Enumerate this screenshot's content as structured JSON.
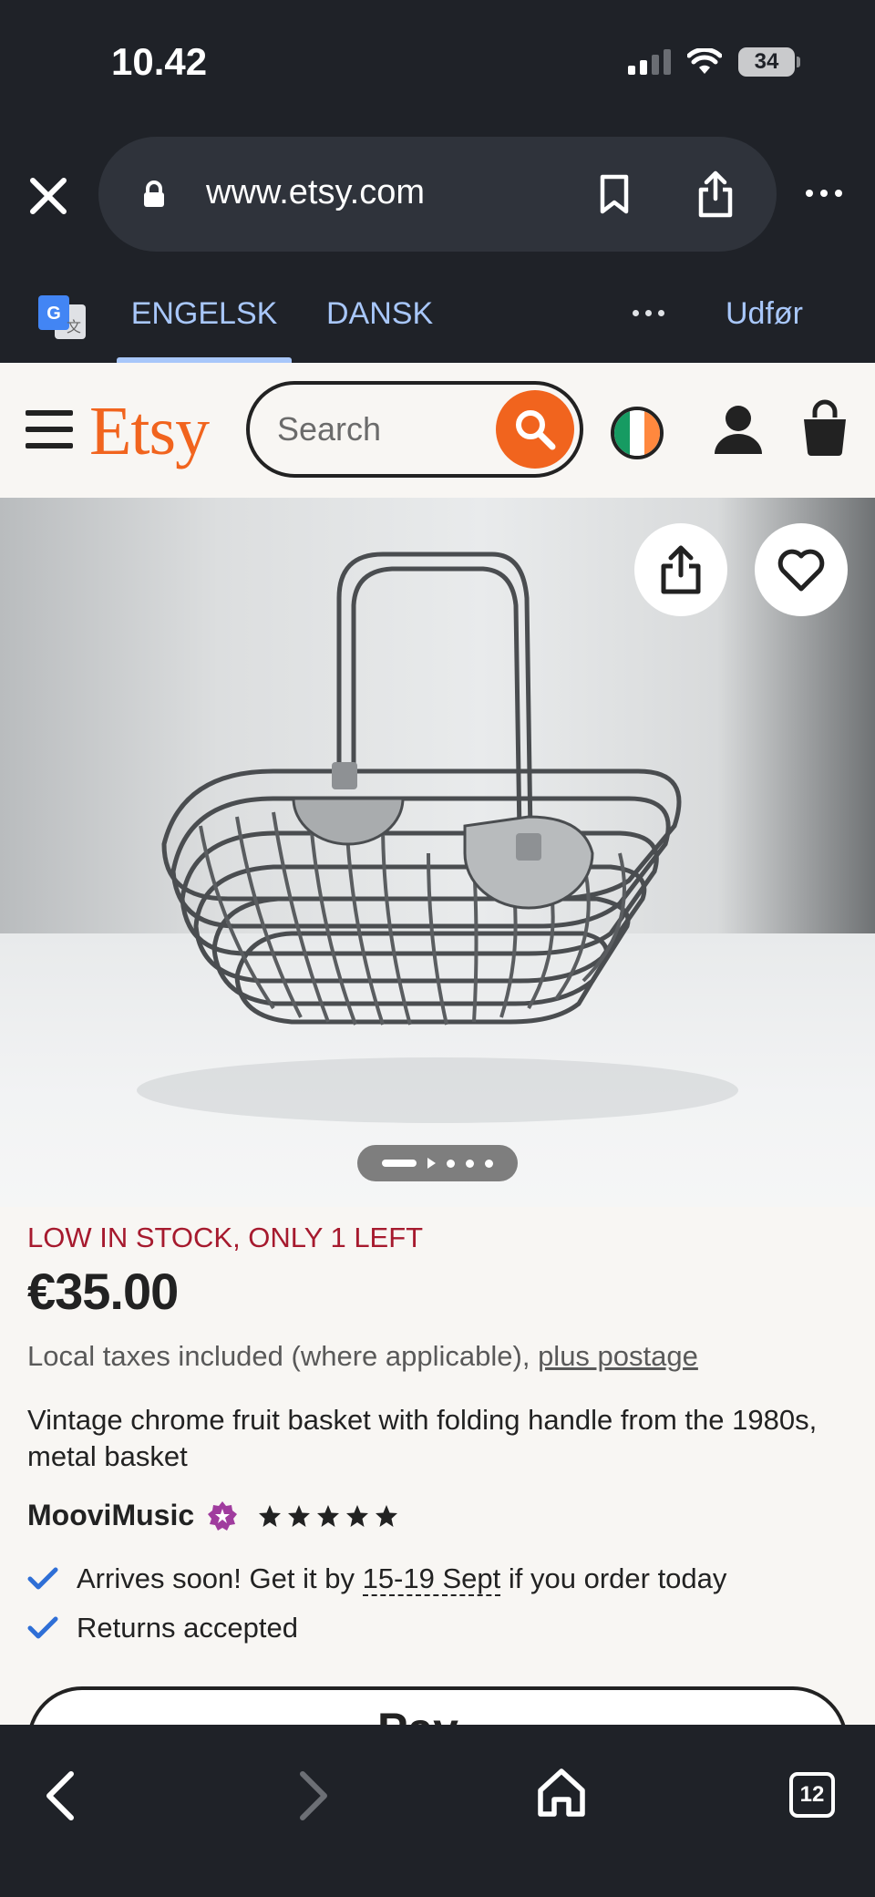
{
  "status_bar": {
    "time": "10.42",
    "battery": "34"
  },
  "browser": {
    "url": "www.etsy.com",
    "translate": {
      "source_lang": "ENGELSK",
      "target_lang": "DANSK",
      "done_label": "Udfør"
    }
  },
  "etsy": {
    "logo": "Etsy",
    "search": {
      "placeholder": "Search"
    }
  },
  "product": {
    "stock_notice": "LOW IN STOCK, ONLY 1 LEFT",
    "price": "€35.00",
    "taxes_text": "Local taxes included (where applicable),",
    "postage_link": "plus postage",
    "title": "Vintage chrome fruit basket with folding handle from the 1980s, metal basket",
    "shop_name": "MooviMusic",
    "rating_stars": 5,
    "arrival_prefix": "Arrives soon! Get it by",
    "arrival_dates": "15-19 Sept",
    "arrival_suffix": "if you order today",
    "returns": "Returns accepted",
    "pay_button_label": "Pay"
  },
  "bottom_nav": {
    "tab_count": "12"
  },
  "colors": {
    "etsy_orange": "#f1641e",
    "stock_red": "#a61a2e",
    "check_blue": "#2f6fd6",
    "star_seller_purple": "#a03c9e"
  }
}
